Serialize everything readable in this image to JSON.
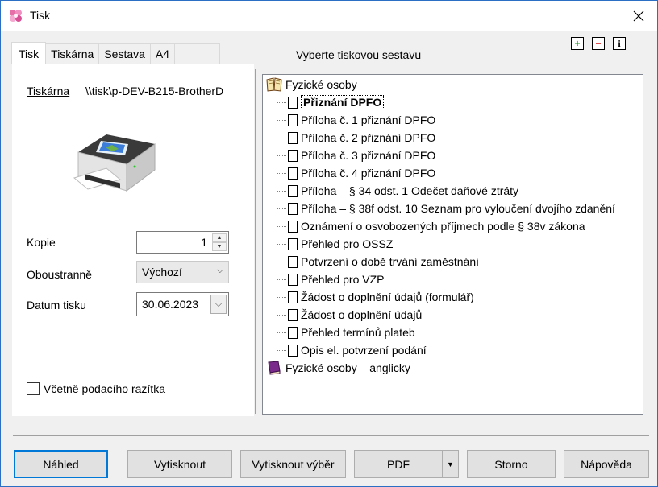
{
  "window": {
    "title": "Tisk"
  },
  "tabs": [
    "Tisk",
    "Tiskárna",
    "Sestava",
    "A4"
  ],
  "left": {
    "printer_label": "Tiskárna",
    "printer_value": "\\\\tisk\\p-DEV-B215-BrotherD",
    "copies_label": "Kopie",
    "copies_value": "1",
    "duplex_label": "Oboustranně",
    "duplex_value": "Výchozí",
    "date_label": "Datum tisku",
    "date_value": "30.06.2023",
    "stamp_label": "Včetně podacího razítka",
    "stamp_checked": false
  },
  "tree": {
    "header": "Vyberte tiskovou sestavu",
    "root1": "Fyzické osoby",
    "items": [
      "Přiznání DPFO",
      "Příloha č. 1 přiznání DPFO",
      "Příloha č. 2 přiznání DPFO",
      "Příloha č. 3 přiznání DPFO",
      "Příloha č. 4 přiznání DPFO",
      "Příloha – § 34 odst. 1 Odečet daňové ztráty",
      "Příloha – § 38f odst. 10 Seznam pro vyloučení dvojího zdanění",
      "Oznámení o osvobozených příjmech podle § 38v zákona",
      "Přehled pro OSSZ",
      "Potvrzení o době trvání zaměstnání",
      "Přehled pro VZP",
      "Žádost o doplnění údajů (formulář)",
      "Žádost o doplnění údajů",
      "Přehled termínů plateb",
      "Opis el. potvrzení podání"
    ],
    "root2": "Fyzické osoby – anglicky"
  },
  "tools": {
    "add": "+",
    "remove": "−",
    "info": "i"
  },
  "buttons": {
    "preview": "Náhled",
    "print": "Vytisknout",
    "print_selection": "Vytisknout výběr",
    "pdf": "PDF",
    "cancel": "Storno",
    "help": "Nápověda"
  },
  "colors": {
    "accent": "#0078d7",
    "titlebar": "#ffffff",
    "dialog": "#f0f0f0"
  }
}
